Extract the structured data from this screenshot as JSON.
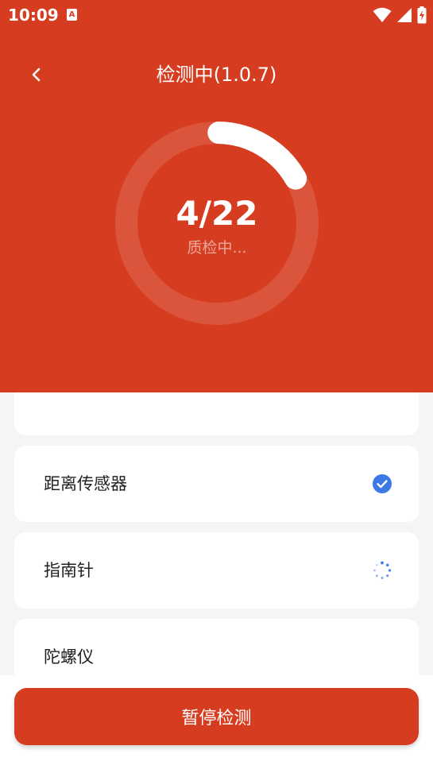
{
  "status_bar": {
    "time": "10:09",
    "notification_icon_letter": "A"
  },
  "header": {
    "title": "检测中(1.0.7)"
  },
  "progress": {
    "count_text": "4/22",
    "status_text": "质检中...",
    "completed": 4,
    "total": 22
  },
  "items": [
    {
      "label": "距离传感器",
      "state": "done",
      "icon": "check-circle-icon"
    },
    {
      "label": "指南针",
      "state": "testing",
      "icon": "spinner-icon"
    },
    {
      "label": "陀螺仪",
      "state": "pending",
      "icon": ""
    }
  ],
  "action": {
    "label": "暂停检测"
  },
  "colors": {
    "brand_red": "#d63c20",
    "check_blue": "#3c78e6"
  }
}
